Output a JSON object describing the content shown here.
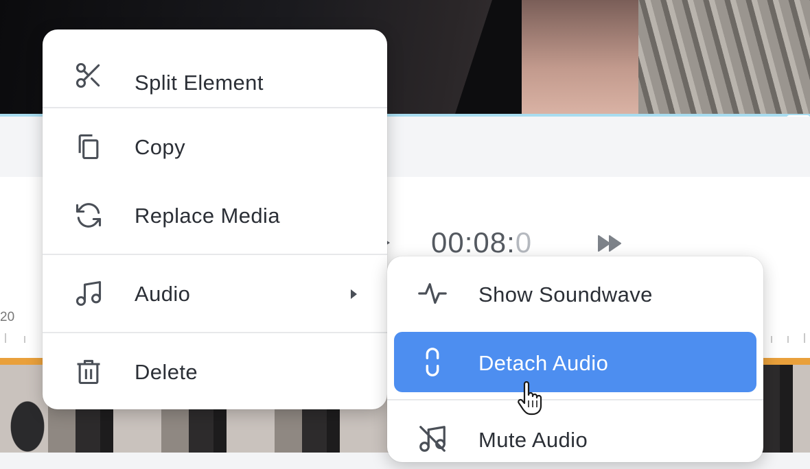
{
  "player": {
    "timecode_main": "00:08:",
    "timecode_dim": "0",
    "ruler_label": "20"
  },
  "context_menu": {
    "items": [
      {
        "label": "Split Element",
        "icon": "scissors-icon"
      },
      {
        "label": "Copy",
        "icon": "copy-icon"
      },
      {
        "label": "Replace Media",
        "icon": "refresh-icon"
      },
      {
        "label": "Audio",
        "icon": "music-note-icon",
        "has_submenu": true
      },
      {
        "label": "Delete",
        "icon": "trash-icon"
      }
    ]
  },
  "audio_submenu": {
    "items": [
      {
        "label": "Show Soundwave",
        "icon": "soundwave-icon"
      },
      {
        "label": "Detach Audio",
        "icon": "unlink-icon",
        "highlighted": true
      },
      {
        "label": "Mute Audio",
        "icon": "mute-icon"
      }
    ]
  },
  "colors": {
    "highlight": "#4d8ef0",
    "timeline_track": "#e9a03b",
    "accent_line": "#a8dcef"
  }
}
